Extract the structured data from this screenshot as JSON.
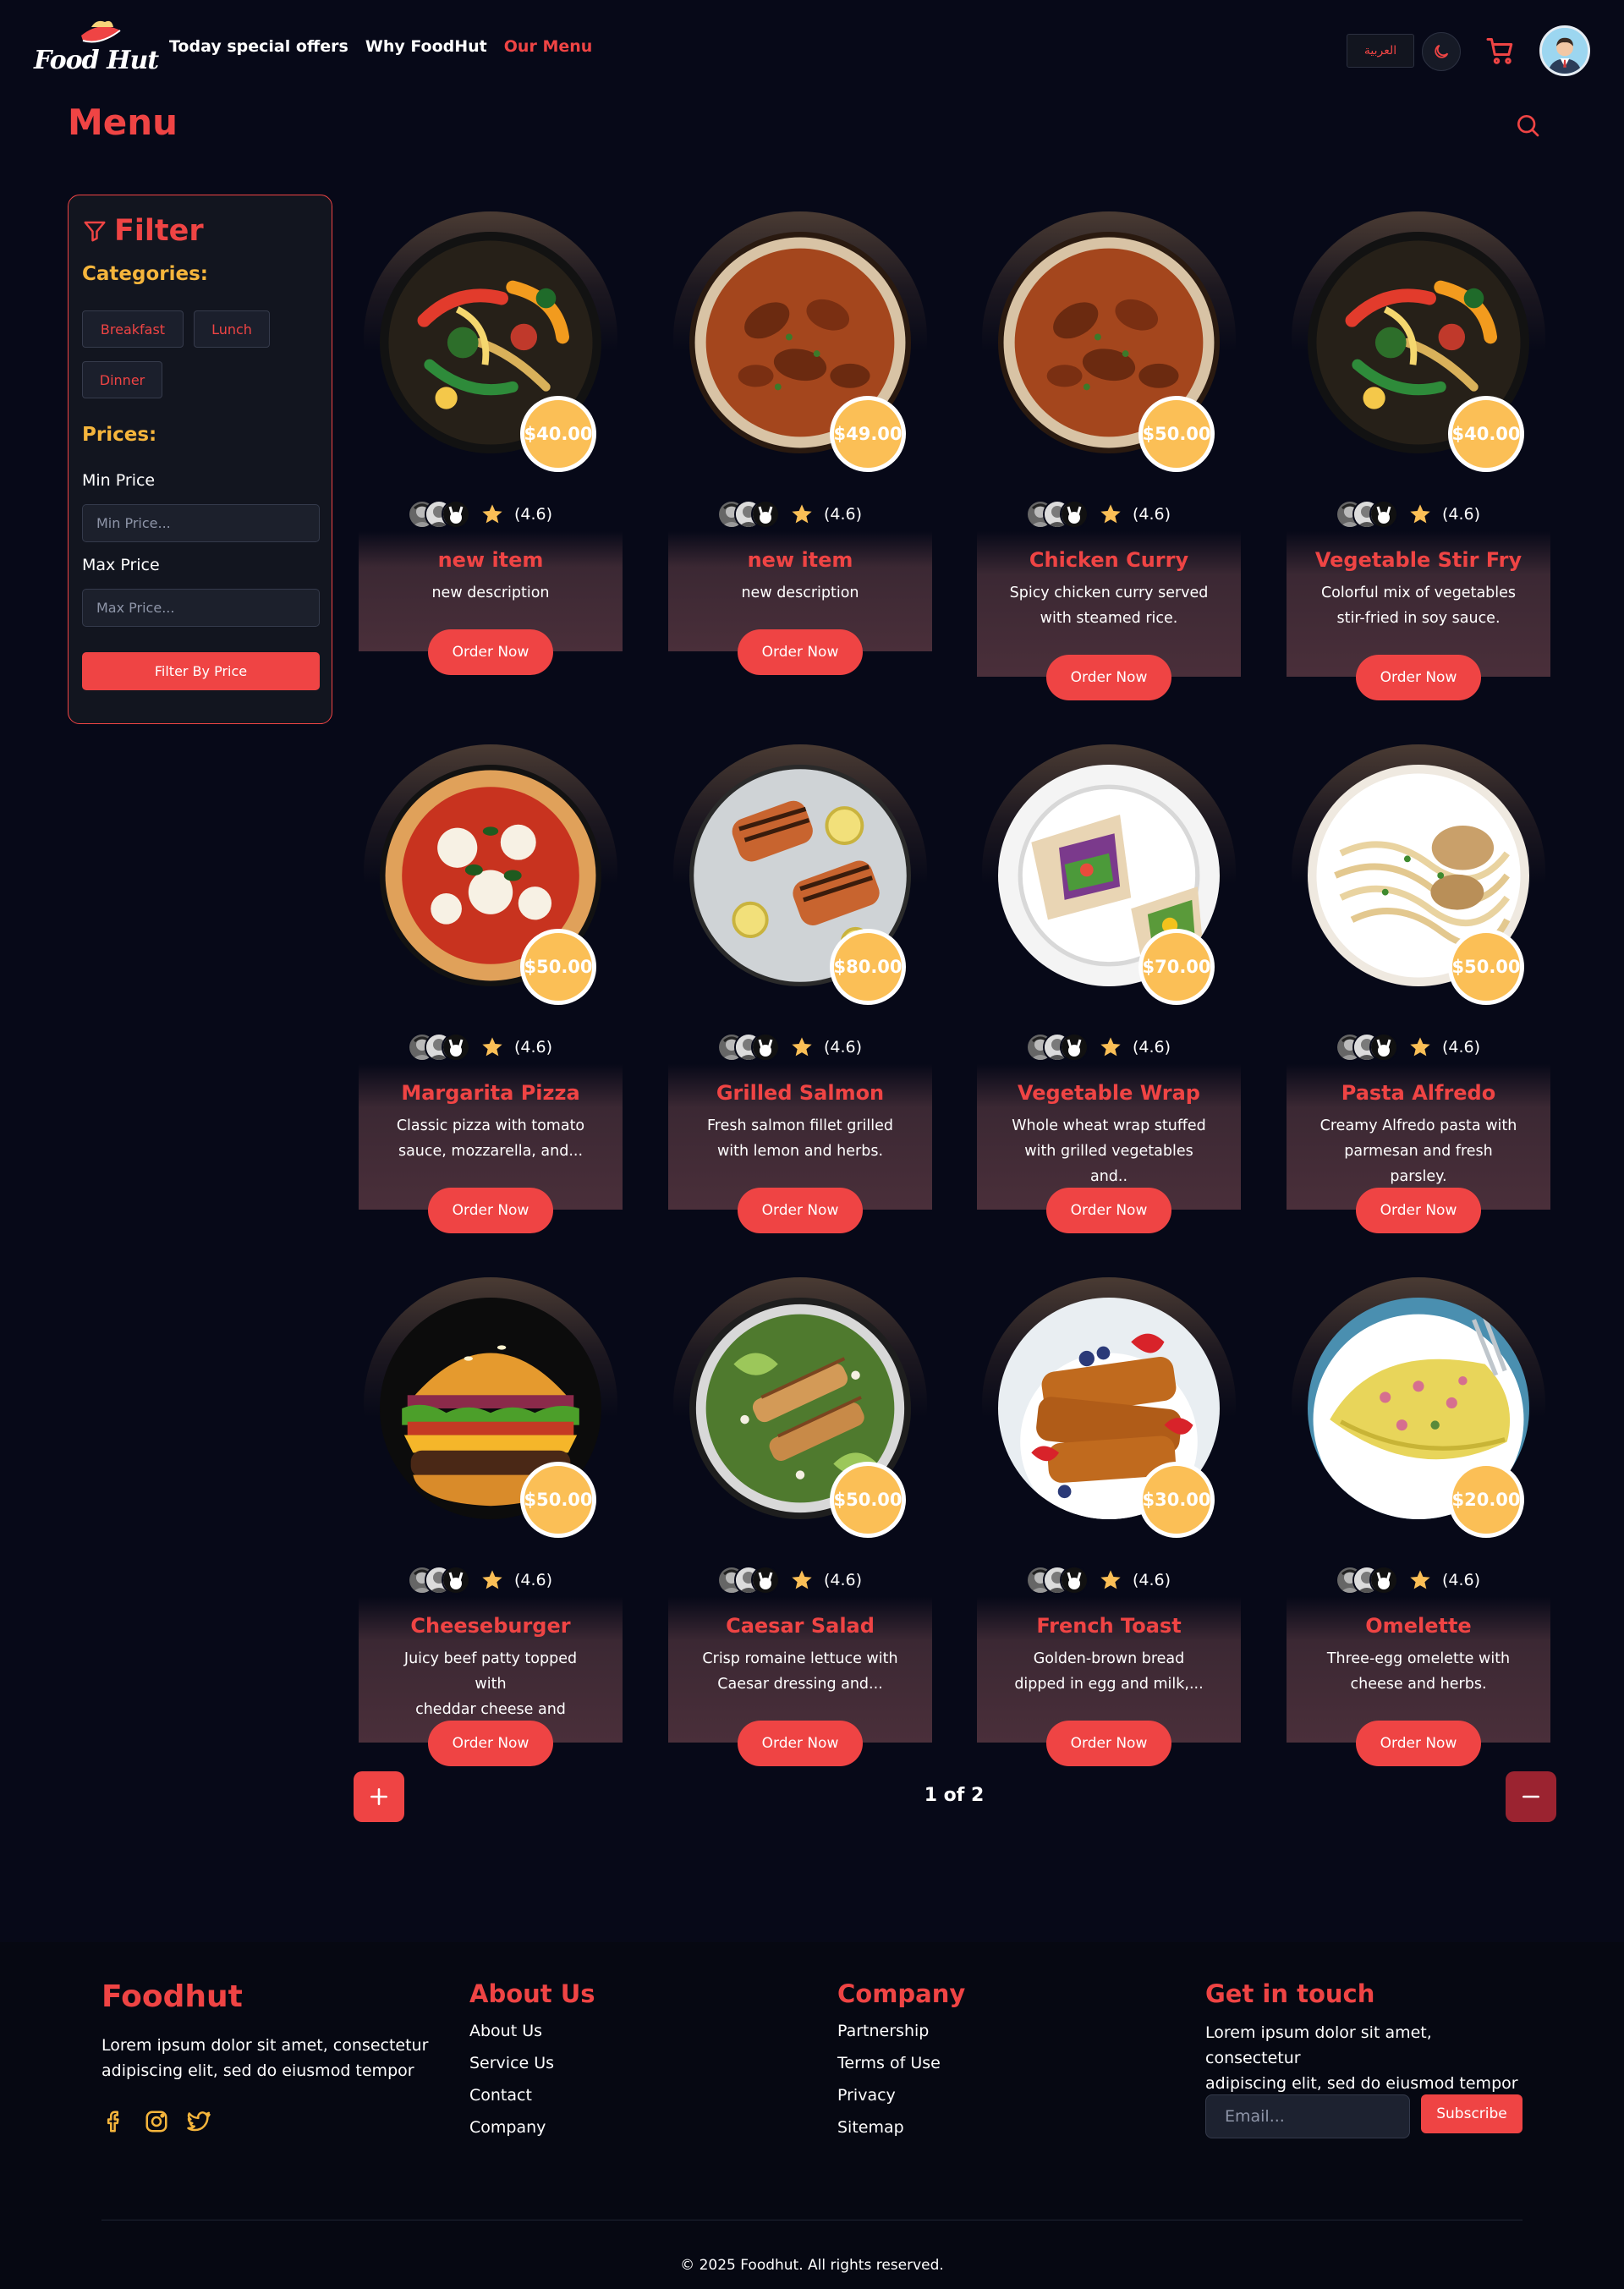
{
  "header": {
    "logo_text": "Food Hut",
    "nav": [
      "Today special offers",
      "Why FoodHut",
      "Our Menu"
    ],
    "active_nav": "Our Menu",
    "lang_label": "العربية"
  },
  "page": {
    "title": "Menu"
  },
  "filter": {
    "title": "Filter",
    "categories_heading": "Categories:",
    "categories": [
      "Breakfast",
      "Lunch",
      "Dinner"
    ],
    "prices_heading": "Prices:",
    "min_label": "Min Price",
    "min_placeholder": "Min Price...",
    "max_label": "Max Price",
    "max_placeholder": "Max Price...",
    "button": "Filter By Price"
  },
  "rating_text": "(4.6)",
  "order_label": "Order Now",
  "menu_items": [
    {
      "name": "new item",
      "desc": "new description",
      "price": "$40.00",
      "img": "stir-fry"
    },
    {
      "name": "new item",
      "desc": "new description",
      "price": "$49.00",
      "img": "curry"
    },
    {
      "name": "Chicken Curry",
      "desc": "Spicy chicken curry served\nwith steamed rice.",
      "price": "$50.00",
      "img": "curry"
    },
    {
      "name": "Vegetable Stir Fry",
      "desc": "Colorful mix of vegetables\nstir-fried in soy sauce.",
      "price": "$40.00",
      "img": "stir-fry"
    },
    {
      "name": "Margarita Pizza",
      "desc": "Classic pizza with tomato\nsauce, mozzarella, and...",
      "price": "$50.00",
      "img": "pizza"
    },
    {
      "name": "Grilled Salmon",
      "desc": "Fresh salmon fillet grilled\nwith lemon and herbs.",
      "price": "$80.00",
      "img": "salmon"
    },
    {
      "name": "Vegetable Wrap",
      "desc": "Whole wheat wrap stuffed\nwith grilled vegetables and..",
      "price": "$70.00",
      "img": "wrap"
    },
    {
      "name": "Pasta Alfredo",
      "desc": "Creamy Alfredo pasta with\nparmesan and fresh parsley.",
      "price": "$50.00",
      "img": "pasta"
    },
    {
      "name": "Cheeseburger",
      "desc": "Juicy beef patty topped with\ncheddar cheese and pickles.",
      "price": "$50.00",
      "img": "burger"
    },
    {
      "name": "Caesar Salad",
      "desc": "Crisp romaine lettuce with\nCaesar dressing and...",
      "price": "$50.00",
      "img": "salad"
    },
    {
      "name": "French Toast",
      "desc": "Golden-brown bread\ndipped in egg and milk,...",
      "price": "$30.00",
      "img": "toast"
    },
    {
      "name": "Omelette",
      "desc": "Three-egg omelette with\ncheese and herbs.",
      "price": "$20.00",
      "img": "omelette"
    }
  ],
  "pagination": {
    "info": "1 of 2",
    "prev_icon": "plus-icon",
    "next_icon": "minus-icon"
  },
  "footer": {
    "brand": "Foodhut",
    "brand_text": "Lorem ipsum dolor sit amet, consectetur\nadipiscing elit, sed do eiusmod tempor",
    "about_heading": "About Us",
    "about_links": [
      "About Us",
      "Service Us",
      "Contact",
      "Company"
    ],
    "company_heading": "Company",
    "company_links": [
      "Partnership",
      "Terms of Use",
      "Privacy",
      "Sitemap"
    ],
    "contact_heading": "Get in touch",
    "contact_text": "Lorem ipsum dolor sit amet, consectetur\nadipiscing elit, sed do eiusmod tempor",
    "email_placeholder": "Email...",
    "subscribe": "Subscribe",
    "copyright": "© 2025 Foodhut. All rights reserved."
  },
  "colors": {
    "accent": "#ef4444",
    "gold": "#fbbf56",
    "heading_gold": "#f5b53c",
    "background": "#070918"
  }
}
